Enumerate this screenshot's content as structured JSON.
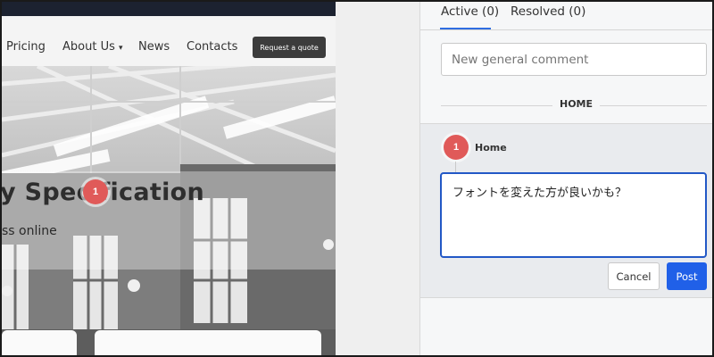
{
  "website": {
    "nav": {
      "pricing": "Pricing",
      "about": "About Us",
      "about_caret": "▾",
      "news": "News",
      "contacts": "Contacts",
      "quote_button": "Request a quote"
    },
    "hero": {
      "title": "y Specification",
      "subtitle": "ss online"
    },
    "pin_number": "1"
  },
  "comments": {
    "tabs": [
      {
        "label": "Active (0)"
      },
      {
        "label": "Resolved (0)"
      }
    ],
    "new_comment_placeholder": "New general comment",
    "section_label": "HOME",
    "thread": {
      "pin_number": "1",
      "name": "Home",
      "reply_text": "フォントを変えた方が良いかも？",
      "cancel_label": "Cancel",
      "post_label": "Post"
    }
  },
  "colors": {
    "accent": "#2060e8",
    "pin": "#e05a59",
    "topbar": "#1c2230"
  }
}
